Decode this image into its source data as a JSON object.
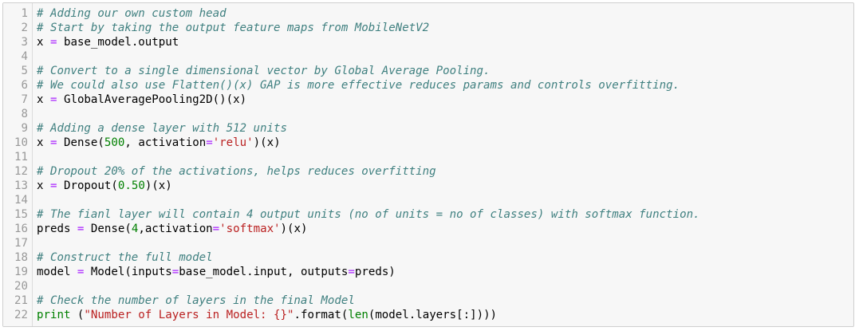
{
  "lines": [
    {
      "n": "1",
      "t": [
        {
          "c": "cm",
          "s": "# Adding our own custom head"
        }
      ]
    },
    {
      "n": "2",
      "t": [
        {
          "c": "cm",
          "s": "# Start by taking the output feature maps from MobileNetV2"
        }
      ]
    },
    {
      "n": "3",
      "t": [
        {
          "c": "",
          "s": "x "
        },
        {
          "c": "op",
          "s": "="
        },
        {
          "c": "",
          "s": " base_model.output"
        }
      ]
    },
    {
      "n": "4",
      "t": []
    },
    {
      "n": "5",
      "t": [
        {
          "c": "cm",
          "s": "# Convert to a single dimensional vector by Global Average Pooling."
        }
      ]
    },
    {
      "n": "6",
      "t": [
        {
          "c": "cm",
          "s": "# We could also use Flatten()(x) GAP is more effective reduces params and controls overfitting."
        }
      ]
    },
    {
      "n": "7",
      "t": [
        {
          "c": "",
          "s": "x "
        },
        {
          "c": "op",
          "s": "="
        },
        {
          "c": "",
          "s": " GlobalAveragePooling2D()(x)"
        }
      ]
    },
    {
      "n": "8",
      "t": []
    },
    {
      "n": "9",
      "t": [
        {
          "c": "cm",
          "s": "# Adding a dense layer with 512 units"
        }
      ]
    },
    {
      "n": "10",
      "t": [
        {
          "c": "",
          "s": "x "
        },
        {
          "c": "op",
          "s": "="
        },
        {
          "c": "",
          "s": " Dense("
        },
        {
          "c": "num",
          "s": "500"
        },
        {
          "c": "",
          "s": ", activation"
        },
        {
          "c": "op",
          "s": "="
        },
        {
          "c": "str",
          "s": "'relu'"
        },
        {
          "c": "",
          "s": ")(x)"
        }
      ]
    },
    {
      "n": "11",
      "t": []
    },
    {
      "n": "12",
      "t": [
        {
          "c": "cm",
          "s": "# Dropout 20% of the activations, helps reduces overfitting"
        }
      ]
    },
    {
      "n": "13",
      "t": [
        {
          "c": "",
          "s": "x "
        },
        {
          "c": "op",
          "s": "="
        },
        {
          "c": "",
          "s": " Dropout("
        },
        {
          "c": "num",
          "s": "0.50"
        },
        {
          "c": "",
          "s": ")(x)"
        }
      ]
    },
    {
      "n": "14",
      "t": []
    },
    {
      "n": "15",
      "t": [
        {
          "c": "cm",
          "s": "# The fianl layer will contain 4 output units (no of units = no of classes) with softmax function."
        }
      ]
    },
    {
      "n": "16",
      "t": [
        {
          "c": "",
          "s": "preds "
        },
        {
          "c": "op",
          "s": "="
        },
        {
          "c": "",
          "s": " Dense("
        },
        {
          "c": "num",
          "s": "4"
        },
        {
          "c": "",
          "s": ",activation"
        },
        {
          "c": "op",
          "s": "="
        },
        {
          "c": "str",
          "s": "'softmax'"
        },
        {
          "c": "",
          "s": ")(x)"
        }
      ]
    },
    {
      "n": "17",
      "t": []
    },
    {
      "n": "18",
      "t": [
        {
          "c": "cm",
          "s": "# Construct the full model"
        }
      ]
    },
    {
      "n": "19",
      "t": [
        {
          "c": "",
          "s": "model "
        },
        {
          "c": "op",
          "s": "="
        },
        {
          "c": "",
          "s": " Model(inputs"
        },
        {
          "c": "op",
          "s": "="
        },
        {
          "c": "",
          "s": "base_model.input, outputs"
        },
        {
          "c": "op",
          "s": "="
        },
        {
          "c": "",
          "s": "preds)"
        }
      ]
    },
    {
      "n": "20",
      "t": []
    },
    {
      "n": "21",
      "t": [
        {
          "c": "cm",
          "s": "# Check the number of layers in the final Model"
        }
      ]
    },
    {
      "n": "22",
      "t": [
        {
          "c": "kw",
          "s": "print"
        },
        {
          "c": "",
          "s": " ("
        },
        {
          "c": "str",
          "s": "\"Number of Layers in Model: {}\""
        },
        {
          "c": "",
          "s": ".format("
        },
        {
          "c": "kw",
          "s": "len"
        },
        {
          "c": "",
          "s": "(model.layers[:])))"
        }
      ]
    }
  ]
}
